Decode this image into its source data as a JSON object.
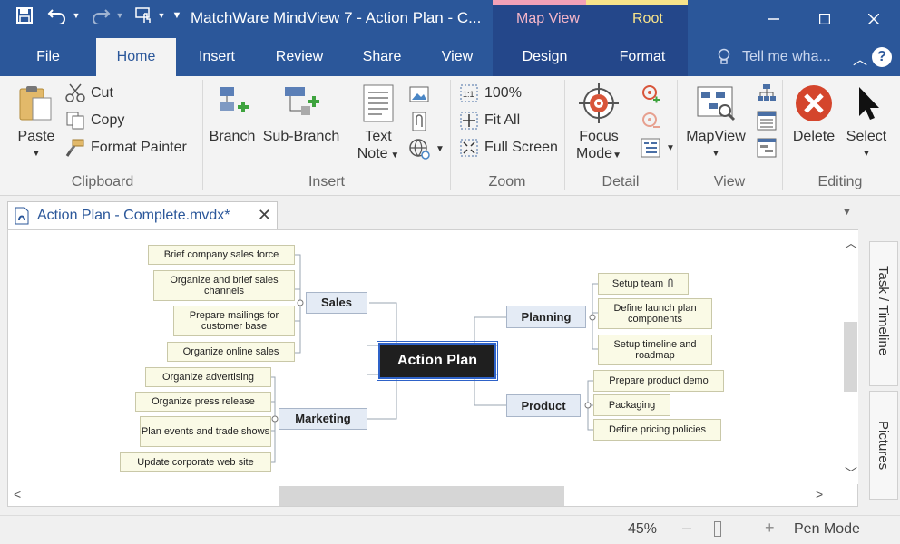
{
  "window": {
    "title": "MatchWare MindView 7 - Action Plan - C...",
    "context_tabs": {
      "map_view": "Map View",
      "root": "Root"
    }
  },
  "tabs": [
    "File",
    "Home",
    "Insert",
    "Review",
    "Share",
    "View",
    "Design",
    "Format"
  ],
  "tell_me": "Tell me wha...",
  "ribbon": {
    "clipboard": {
      "paste": "Paste",
      "cut": "Cut",
      "copy": "Copy",
      "format_painter": "Format Painter",
      "label": "Clipboard"
    },
    "insert": {
      "branch": "Branch",
      "sub_branch": "Sub-Branch",
      "text_note_line1": "Text",
      "text_note_line2": "Note",
      "label": "Insert"
    },
    "zoom": {
      "pct": "100%",
      "fit_all": "Fit All",
      "full_screen": "Full Screen",
      "label": "Zoom"
    },
    "detail": {
      "focus_line1": "Focus",
      "focus_line2": "Mode",
      "label": "Detail"
    },
    "view": {
      "mapview": "MapView",
      "label": "View"
    },
    "editing": {
      "delete": "Delete",
      "select": "Select",
      "label": "Editing"
    }
  },
  "document_tab": "Action Plan - Complete.mvdx*",
  "side_tabs": [
    "Task / Timeline",
    "Pictures"
  ],
  "map": {
    "root": "Action Plan",
    "branches": {
      "sales": "Sales",
      "marketing": "Marketing",
      "planning": "Planning",
      "product": "Product"
    },
    "sales_items": [
      "Brief company sales force",
      "Organize and brief sales channels",
      "Prepare mailings for customer base",
      "Organize online sales"
    ],
    "marketing_items": [
      "Organize advertising",
      "Organize press release",
      "Plan events and trade shows",
      "Update corporate web site"
    ],
    "planning_items": [
      "Setup team",
      "Define launch plan components",
      "Setup timeline and roadmap"
    ],
    "product_items": [
      "Prepare product demo",
      "Packaging",
      "Define pricing policies"
    ]
  },
  "status": {
    "zoom": "45%",
    "mode": "Pen Mode"
  },
  "colors": {
    "titlebar": "#2b579a",
    "accent": "#2b579a",
    "root_fill": "#1f1f1f",
    "branch_fill": "#e4ebf5",
    "leaf_fill": "#fafae6"
  }
}
